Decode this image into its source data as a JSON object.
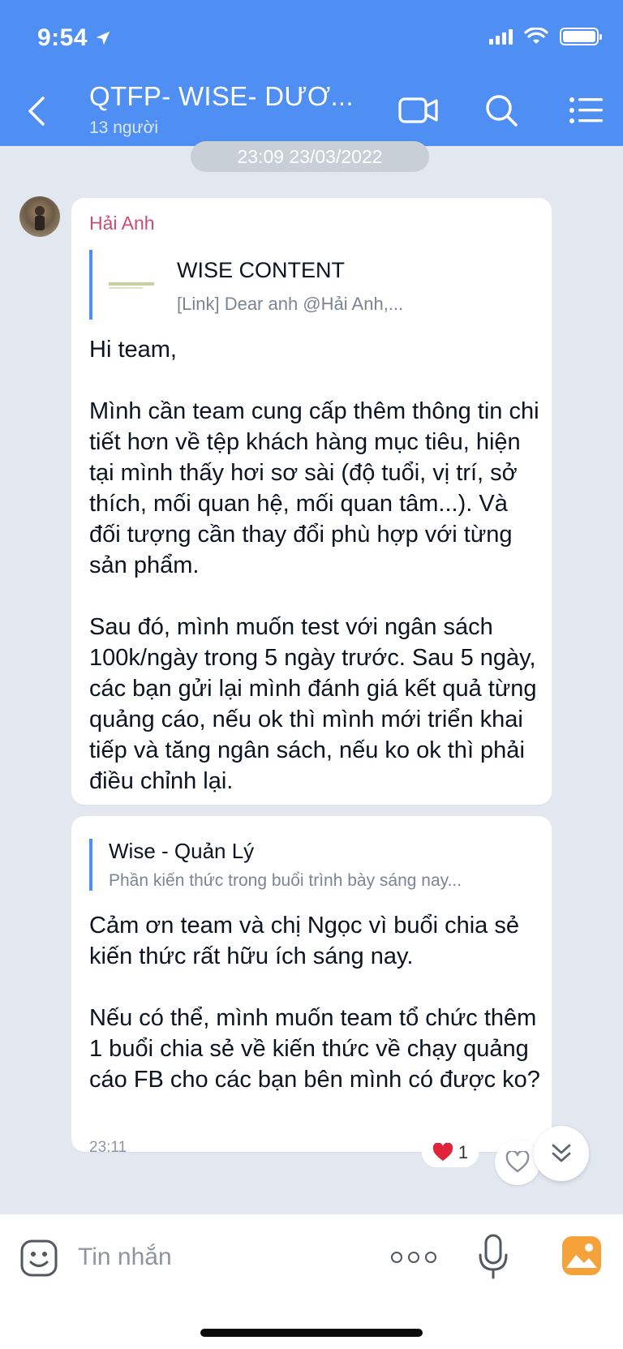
{
  "status_bar": {
    "time": "9:54"
  },
  "header": {
    "title": "QTFP- WISE- DƯƠ...",
    "subtitle": "13 người"
  },
  "date_separator": "23:09 23/03/2022",
  "messages": [
    {
      "sender": "Hải Anh",
      "quote": {
        "title": "WISE CONTENT",
        "preview": "[Link] Dear anh @Hải Anh,..."
      },
      "text": "Hi team,\n\nMình cần team cung cấp thêm thông tin chi tiết hơn về tệp khách hàng mục tiêu, hiện tại mình thấy hơi sơ sài (độ tuổi, vị trí, sở thích, mối quan hệ, mối quan tâm...). Và đối tượng cần thay đổi phù hợp với từng sản phẩm.\n\nSau đó, mình muốn test với ngân sách 100k/ngày trong 5 ngày trước. Sau 5 ngày, các bạn gửi lại mình đánh giá kết quả từng quảng cáo, nếu ok thì mình mới triển khai tiếp và tăng ngân sách, nếu ko ok thì phải điều chỉnh lại."
    },
    {
      "quote": {
        "title": "Wise - Quản Lý",
        "preview": "Phần kiến thức trong buổi trình bày sáng nay..."
      },
      "text": "Cảm ơn team và chị Ngọc vì buổi chia sẻ kiến thức rất hữu ích sáng nay.\n\nNếu có thể, mình muốn team tổ chức thêm 1 buổi chia sẻ về kiến thức về chạy quảng cáo FB cho các bạn bên mình có được ko?",
      "time": "23:11",
      "reactions": {
        "heart_count": "1"
      }
    }
  ],
  "composer": {
    "placeholder": "Tin nhắn"
  },
  "colors": {
    "header_bg": "#4f8ff4",
    "chat_bg": "#e3e8f0",
    "sender_name": "#c84d72",
    "quote_bar": "#4f8ff4",
    "image_button": "#f5a23a"
  },
  "icons": {
    "header": [
      "back-icon",
      "video-call-icon",
      "search-icon",
      "menu-icon"
    ],
    "composer": [
      "emoji-icon",
      "more-icon",
      "microphone-icon",
      "image-icon"
    ],
    "reactions": [
      "heart-icon",
      "like-heart-outline-icon"
    ],
    "other": [
      "scroll-down-icon"
    ]
  }
}
